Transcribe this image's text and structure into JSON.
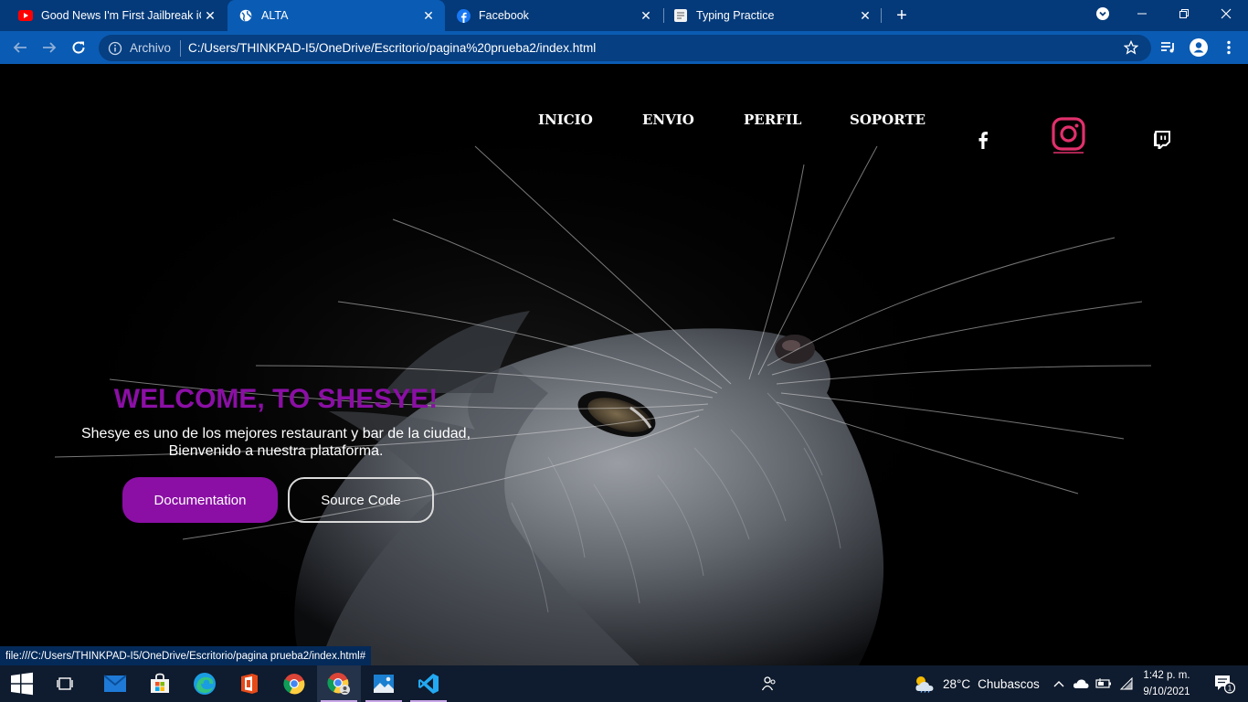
{
  "browser": {
    "tabs": [
      {
        "title": "Good News I'm First Jailbreak iOS",
        "favicon": "youtube-icon",
        "active": false
      },
      {
        "title": "ALTA",
        "favicon": "globe-icon",
        "active": true
      },
      {
        "title": "Facebook",
        "favicon": "facebook-icon",
        "active": false
      },
      {
        "title": "Typing Practice",
        "favicon": "page-icon",
        "active": false
      }
    ],
    "close_glyph": "✕",
    "new_tab_glyph": "+",
    "omnibox": {
      "chip": "Archivo",
      "url": "C:/Users/THINKPAD-I5/OneDrive/Escritorio/pagina%20prueba2/index.html"
    },
    "status_url": "file:///C:/Users/THINKPAD-I5/OneDrive/Escritorio/pagina prueba2/index.html#"
  },
  "site": {
    "nav": [
      "INICIO",
      "ENVIO",
      "PERFIL",
      "SOPORTE"
    ],
    "social": [
      "facebook-icon",
      "instagram-icon",
      "twitch-icon"
    ],
    "hero": {
      "title": "WELCOME, TO SHESYE!",
      "line1": "Shesye es uno de los mejores restaurant y bar de la ciudad,",
      "line2": "Bienvenido a nuestra plataforma.",
      "primary_button": "Documentation",
      "secondary_button": "Source Code"
    },
    "colors": {
      "accent": "#8b0fa5",
      "instagram": "#e1306c"
    }
  },
  "taskbar": {
    "weather": {
      "temp": "28°C",
      "condition": "Chubascos"
    },
    "time": "1:42 p. m.",
    "date": "9/10/2021",
    "notifications": "1"
  }
}
